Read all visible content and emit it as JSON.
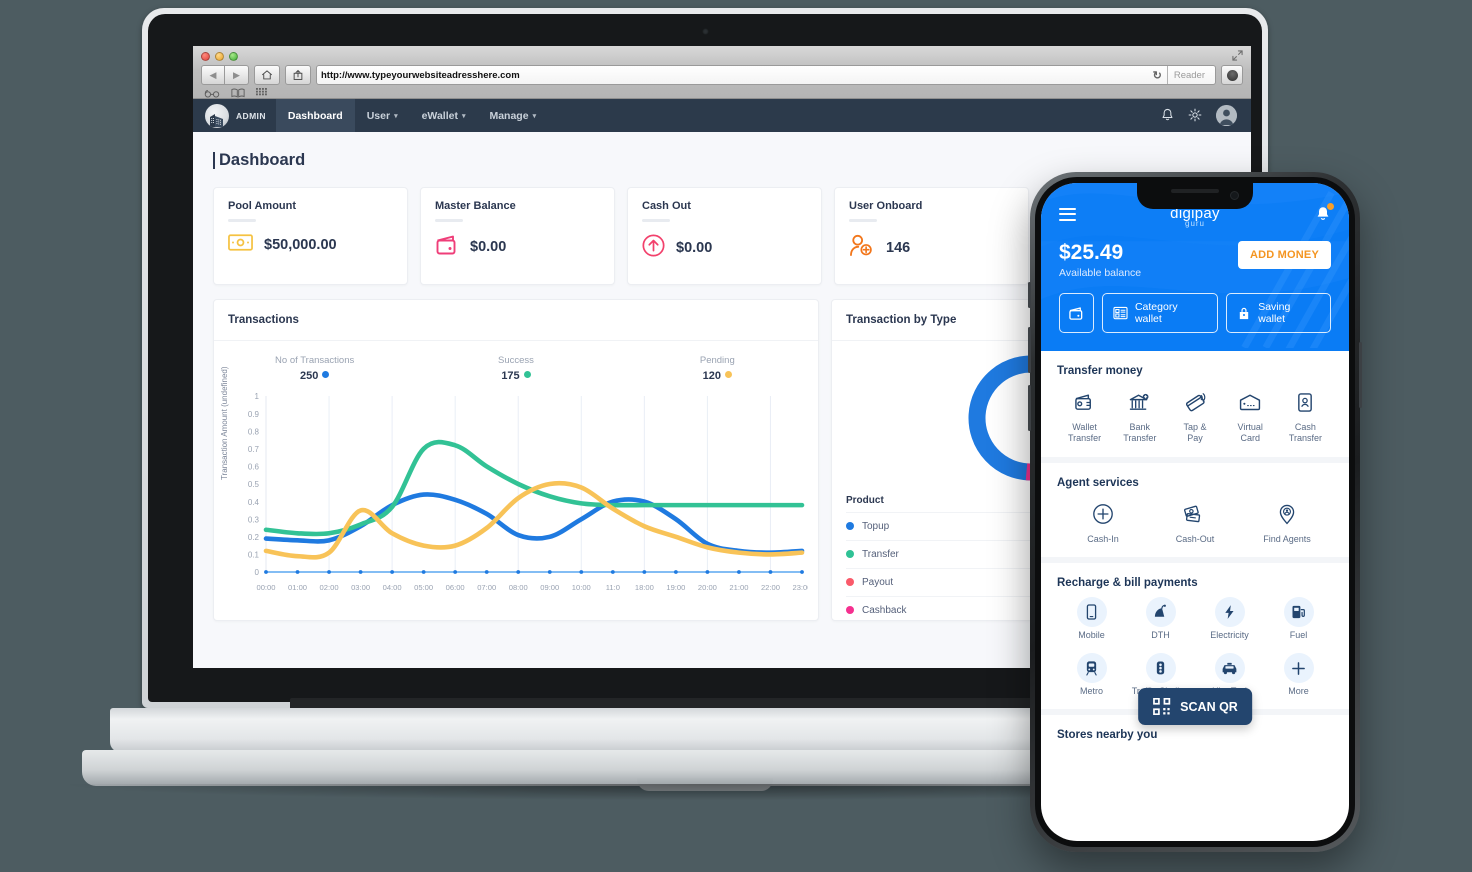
{
  "browser": {
    "url": "http://www.typeyourwebsiteadresshere.com",
    "reader_label": "Reader",
    "reload_icon": "reload-icon",
    "back_icon": "back-arrow-icon",
    "forward_icon": "forward-arrow-icon",
    "home_icon": "home-icon",
    "share_icon": "share-icon",
    "glasses_icon": "reading-list-icon",
    "book_icon": "bookmarks-icon",
    "grid_icon": "top-sites-icon",
    "expand_icon": "fullscreen-icon",
    "prefs_icon": "settings-icon"
  },
  "navbar": {
    "brand": "ADMIN",
    "items": [
      {
        "label": "Dashboard",
        "caret": "",
        "active": true
      },
      {
        "label": "User",
        "caret": "⌄",
        "active": false
      },
      {
        "label": "eWallet",
        "caret": "⌄",
        "active": false
      },
      {
        "label": "Manage",
        "caret": "⌄",
        "active": false
      }
    ],
    "bell_icon": "bell-icon",
    "gear_icon": "gear-icon",
    "avatar_icon": "user-avatar-icon"
  },
  "page": {
    "title": "Dashboard"
  },
  "cards": [
    {
      "title": "Pool Amount",
      "value": "$50,000.00",
      "icon": "banknote-icon",
      "color": "#f5c242"
    },
    {
      "title": "Master Balance",
      "value": "$0.00",
      "icon": "wallet-icon",
      "color": "#ef3e79"
    },
    {
      "title": "Cash Out",
      "value": "$0.00",
      "icon": "arrow-up-circle-icon",
      "color": "#f2416c"
    },
    {
      "title": "User Onboard",
      "value": "146",
      "icon": "user-add-icon",
      "color": "#f2761b"
    }
  ],
  "transactions_panel": {
    "title": "Transactions",
    "stats": [
      {
        "label": "No of Transactions",
        "value": "250",
        "color": "#1f7ae0"
      },
      {
        "label": "Success",
        "value": "175",
        "color": "#32c295"
      },
      {
        "label": "Pending",
        "value": "120",
        "color": "#f8c358"
      }
    ]
  },
  "type_panel": {
    "title": "Transaction by Type",
    "legend_header": "Product",
    "legend": [
      {
        "label": "Topup",
        "color": "#1f7ae0"
      },
      {
        "label": "Transfer",
        "color": "#2fc295"
      },
      {
        "label": "Payout",
        "color": "#fa5a6a"
      },
      {
        "label": "Cashback",
        "color": "#f5308f"
      }
    ]
  },
  "chart_data": [
    {
      "type": "line",
      "title": "Transactions",
      "xlabel": "",
      "ylabel": "Transaction Amount (undefined)",
      "ylim": [
        0,
        1
      ],
      "yticks": [
        "0",
        "0.1",
        "0.2",
        "0.3",
        "0.4",
        "0.5",
        "0.6",
        "0.7",
        "0.8",
        "0.9",
        "1"
      ],
      "grid": true,
      "legend_position": "top",
      "categories": [
        "00:00",
        "01:00",
        "02:00",
        "03:00",
        "04:00",
        "05:00",
        "06:00",
        "07:00",
        "08:00",
        "09:00",
        "10:00",
        "11:0",
        "18:00",
        "19:00",
        "20:00",
        "21:00",
        "22:00",
        "23:00"
      ],
      "series": [
        {
          "name": "No of Transactions",
          "color": "#1f7ae0",
          "values": [
            0.19,
            0.18,
            0.18,
            0.26,
            0.38,
            0.44,
            0.41,
            0.33,
            0.21,
            0.2,
            0.3,
            0.4,
            0.4,
            0.3,
            0.16,
            0.12,
            0.11,
            0.12
          ]
        },
        {
          "name": "Success",
          "color": "#32c295",
          "values": [
            0.24,
            0.22,
            0.22,
            0.27,
            0.37,
            0.7,
            0.72,
            0.6,
            0.5,
            0.43,
            0.39,
            0.38,
            0.38,
            0.38,
            0.38,
            0.38,
            0.38,
            0.38
          ]
        },
        {
          "name": "Pending",
          "color": "#f8c358",
          "values": [
            0.12,
            0.09,
            0.11,
            0.35,
            0.22,
            0.15,
            0.15,
            0.25,
            0.42,
            0.5,
            0.48,
            0.36,
            0.26,
            0.2,
            0.14,
            0.11,
            0.1,
            0.11
          ]
        }
      ]
    },
    {
      "type": "pie",
      "title": "Transaction by Type",
      "labels": [
        "Topup",
        "Transfer",
        "Payout",
        "Cashback"
      ],
      "values": [
        52,
        27,
        13,
        8
      ],
      "colors": [
        "#1f7ae0",
        "#2fc295",
        "#fa5a6a",
        "#f5308f"
      ],
      "legend_position": "bottom"
    }
  ],
  "phone": {
    "logo_main": "digipay",
    "logo_sub": "guru",
    "menu_icon": "hamburger-menu-icon",
    "bell_icon": "bell-icon",
    "balance": "$25.49",
    "balance_label": "Available balance",
    "add_money_label": "ADD MONEY",
    "chips": [
      {
        "label": "",
        "icon": "wallet-icon"
      },
      {
        "label": "Category wallet",
        "icon": "category-wallet-icon"
      },
      {
        "label": "Saving wallet",
        "icon": "piggy-bank-icon"
      }
    ],
    "sections": [
      {
        "title": "Transfer money",
        "tiles": [
          {
            "label": "Wallet\nTransfer",
            "icon": "wallet-transfer-icon"
          },
          {
            "label": "Bank\nTransfer",
            "icon": "bank-transfer-icon"
          },
          {
            "label": "Tap &\nPay",
            "icon": "tap-pay-icon"
          },
          {
            "label": "Virtual\nCard",
            "icon": "virtual-card-icon"
          },
          {
            "label": "Cash\nTransfer",
            "icon": "cash-transfer-icon"
          }
        ]
      },
      {
        "title": "Agent services",
        "tiles": [
          {
            "label": "Cash-In",
            "icon": "plus-circle-icon"
          },
          {
            "label": "Cash-Out",
            "icon": "cash-out-icon"
          },
          {
            "label": "Find Agents",
            "icon": "map-pin-agent-icon"
          }
        ]
      },
      {
        "title": "Recharge & bill payments",
        "tiles": [
          {
            "label": "Mobile",
            "icon": "mobile-icon"
          },
          {
            "label": "DTH",
            "icon": "satellite-dish-icon"
          },
          {
            "label": "Electricity",
            "icon": "bolt-icon"
          },
          {
            "label": "Fuel",
            "icon": "fuel-pump-icon"
          },
          {
            "label": "Metro",
            "icon": "metro-icon"
          },
          {
            "label": "Traffic Challan",
            "icon": "traffic-light-icon"
          },
          {
            "label": "Hire Taxi",
            "icon": "taxi-icon"
          },
          {
            "label": "More",
            "icon": "plus-icon"
          }
        ]
      },
      {
        "title": "Stores nearby you",
        "tiles": []
      }
    ],
    "scan_qr_label": "SCAN QR",
    "scan_qr_icon": "qr-code-icon"
  }
}
